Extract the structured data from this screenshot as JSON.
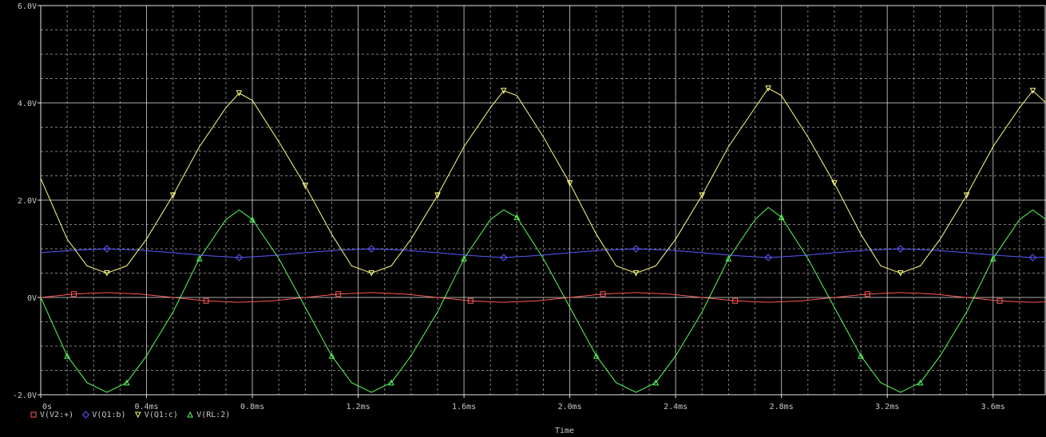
{
  "chart_data": {
    "type": "line",
    "xlabel": "Time",
    "ylabel": "",
    "xlim_ms": [
      0,
      3.8
    ],
    "ylim": [
      -2,
      6
    ],
    "grid": true,
    "x_ticks": [
      {
        "v": 0,
        "label": "0s"
      },
      {
        "v": 0.4,
        "label": "0.4ms"
      },
      {
        "v": 0.8,
        "label": "0.8ms"
      },
      {
        "v": 1.2,
        "label": "1.2ms"
      },
      {
        "v": 1.6,
        "label": "1.6ms"
      },
      {
        "v": 2.0,
        "label": "2.0ms"
      },
      {
        "v": 2.4,
        "label": "2.4ms"
      },
      {
        "v": 2.8,
        "label": "2.8ms"
      },
      {
        "v": 3.2,
        "label": "3.2ms"
      },
      {
        "v": 3.6,
        "label": "3.6ms"
      }
    ],
    "y_ticks": [
      {
        "v": 6,
        "label": "6.0V"
      },
      {
        "v": 4,
        "label": "4.0V"
      },
      {
        "v": 2,
        "label": "2.0V"
      },
      {
        "v": 0,
        "label": "0V"
      },
      {
        "v": -2,
        "label": "-2.0V"
      }
    ],
    "legend_position": "bottom-left",
    "series": [
      {
        "name": "V(V2:+)",
        "color": "#ff5a5a",
        "marker": "square",
        "x": [
          0,
          0.125,
          0.25,
          0.375,
          0.5,
          0.625,
          0.75,
          0.875,
          1.0,
          1.125,
          1.25,
          1.375,
          1.5,
          1.625,
          1.75,
          1.875,
          2.0,
          2.125,
          2.25,
          2.375,
          2.5,
          2.625,
          2.75,
          2.875,
          3.0,
          3.125,
          3.25,
          3.375,
          3.5,
          3.625,
          3.75,
          3.8
        ],
        "values": [
          0,
          0.07,
          0.1,
          0.07,
          0,
          -0.07,
          -0.1,
          -0.07,
          0,
          0.07,
          0.1,
          0.07,
          0,
          -0.07,
          -0.1,
          -0.07,
          0,
          0.07,
          0.1,
          0.07,
          0,
          -0.07,
          -0.1,
          -0.07,
          0,
          0.07,
          0.1,
          0.07,
          0,
          -0.07,
          -0.1,
          -0.09
        ]
      },
      {
        "name": "V(Q1:b)",
        "color": "#5a5aff",
        "marker": "diamond",
        "x": [
          0,
          0.125,
          0.25,
          0.375,
          0.5,
          0.625,
          0.75,
          0.875,
          1.0,
          1.125,
          1.25,
          1.375,
          1.5,
          1.625,
          1.75,
          1.875,
          2.0,
          2.125,
          2.25,
          2.375,
          2.5,
          2.625,
          2.75,
          2.875,
          3.0,
          3.125,
          3.25,
          3.375,
          3.5,
          3.625,
          3.75,
          3.8
        ],
        "values": [
          0.92,
          0.97,
          1.0,
          0.97,
          0.92,
          0.86,
          0.82,
          0.86,
          0.92,
          0.97,
          1.0,
          0.97,
          0.92,
          0.86,
          0.82,
          0.86,
          0.92,
          0.97,
          1.0,
          0.97,
          0.92,
          0.86,
          0.82,
          0.86,
          0.92,
          0.97,
          1.0,
          0.97,
          0.92,
          0.86,
          0.82,
          0.83
        ]
      },
      {
        "name": "V(Q1:c)",
        "color": "#ffff80",
        "marker": "triangle-down",
        "x": [
          0,
          0.1,
          0.175,
          0.25,
          0.325,
          0.4,
          0.5,
          0.6,
          0.7,
          0.75,
          0.8,
          0.9,
          1.0,
          1.1,
          1.175,
          1.25,
          1.325,
          1.4,
          1.5,
          1.6,
          1.7,
          1.75,
          1.8,
          1.9,
          2.0,
          2.1,
          2.175,
          2.25,
          2.325,
          2.4,
          2.5,
          2.6,
          2.7,
          2.75,
          2.8,
          2.9,
          3.0,
          3.1,
          3.175,
          3.25,
          3.325,
          3.4,
          3.5,
          3.6,
          3.7,
          3.75,
          3.8
        ],
        "values": [
          2.45,
          1.2,
          0.65,
          0.5,
          0.65,
          1.2,
          2.1,
          3.1,
          3.9,
          4.2,
          4.05,
          3.2,
          2.3,
          1.3,
          0.65,
          0.5,
          0.65,
          1.2,
          2.1,
          3.1,
          3.9,
          4.25,
          4.15,
          3.3,
          2.35,
          1.3,
          0.65,
          0.5,
          0.65,
          1.2,
          2.1,
          3.1,
          3.9,
          4.3,
          4.15,
          3.3,
          2.35,
          1.3,
          0.65,
          0.5,
          0.65,
          1.2,
          2.1,
          3.1,
          3.9,
          4.25,
          4.0
        ]
      },
      {
        "name": "V(RL:2)",
        "color": "#5aff5a",
        "marker": "triangle-up",
        "x": [
          0,
          0.1,
          0.175,
          0.25,
          0.325,
          0.4,
          0.5,
          0.6,
          0.7,
          0.75,
          0.8,
          0.9,
          1.0,
          1.1,
          1.175,
          1.25,
          1.325,
          1.4,
          1.5,
          1.6,
          1.7,
          1.75,
          1.8,
          1.9,
          2.0,
          2.1,
          2.175,
          2.25,
          2.325,
          2.4,
          2.5,
          2.6,
          2.7,
          2.75,
          2.8,
          2.9,
          3.0,
          3.1,
          3.175,
          3.25,
          3.325,
          3.4,
          3.5,
          3.6,
          3.7,
          3.75,
          3.8
        ],
        "values": [
          0,
          -1.2,
          -1.75,
          -1.95,
          -1.75,
          -1.2,
          -0.3,
          0.8,
          1.6,
          1.8,
          1.6,
          0.8,
          -0.2,
          -1.2,
          -1.75,
          -1.95,
          -1.75,
          -1.2,
          -0.3,
          0.8,
          1.6,
          1.8,
          1.65,
          0.8,
          -0.2,
          -1.2,
          -1.75,
          -1.95,
          -1.75,
          -1.2,
          -0.3,
          0.8,
          1.6,
          1.85,
          1.65,
          0.8,
          -0.2,
          -1.2,
          -1.75,
          -1.95,
          -1.75,
          -1.2,
          -0.3,
          0.8,
          1.6,
          1.8,
          1.6
        ]
      }
    ]
  },
  "colors": {
    "background": "#000000",
    "grid": "#e6e6e6",
    "axis_text": "#c8c8c8"
  }
}
